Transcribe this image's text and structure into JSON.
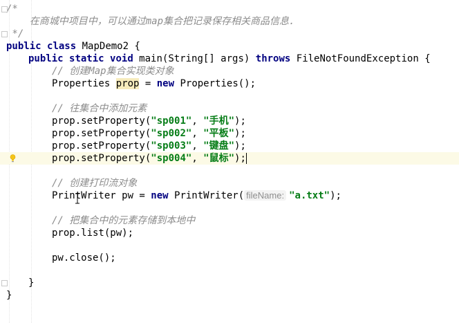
{
  "editor": {
    "comment_open": "/*",
    "comment_body": "    在商城中项目中，可以通过map集合把记录保存相关商品信息.",
    "comment_close": " */",
    "class_decl": {
      "kw1": "public",
      "kw2": "class",
      "name": " MapDemo2 {"
    },
    "method_decl": {
      "kw1": "public",
      "kw2": "static",
      "kw3": "void",
      "sig": " main(String[] args) ",
      "kw4": "throws",
      "rest": " FileNotFoundException {"
    },
    "comment_create_map": "// 创建Map集合实现类对象",
    "props_line": {
      "type": "Properties ",
      "var": "prop",
      "eq": " = ",
      "kw_new": "new",
      "ctor": " Properties();"
    },
    "comment_add": "// 往集合中添加元素",
    "set_calls": [
      {
        "prefix": "prop.setProperty(",
        "key": "\"sp001\"",
        "sep": ", ",
        "value": "\"手机\"",
        "suffix": ");"
      },
      {
        "prefix": "prop.setProperty(",
        "key": "\"sp002\"",
        "sep": ", ",
        "value": "\"平板\"",
        "suffix": ");"
      },
      {
        "prefix": "prop.setProperty(",
        "key": "\"sp003\"",
        "sep": ", ",
        "value": "\"键盘\"",
        "suffix": ");"
      },
      {
        "prefix": "prop.setProperty(",
        "key": "\"sp004\"",
        "sep": ", ",
        "value": "\"鼠标\"",
        "suffix": ");"
      }
    ],
    "comment_printstream": "// 创建打印流对象",
    "pw_line": {
      "decl": "PrintWriter pw = ",
      "kw_new": "new",
      "ctor": " PrintWriter(",
      "hint": "fileName:",
      "arg": "\"a.txt\"",
      "end": ");"
    },
    "comment_store": "// 把集合中的元素存储到本地中",
    "list_line": "prop.list(pw);",
    "close_line": "pw.close();",
    "method_close": "}",
    "class_close": "}"
  }
}
